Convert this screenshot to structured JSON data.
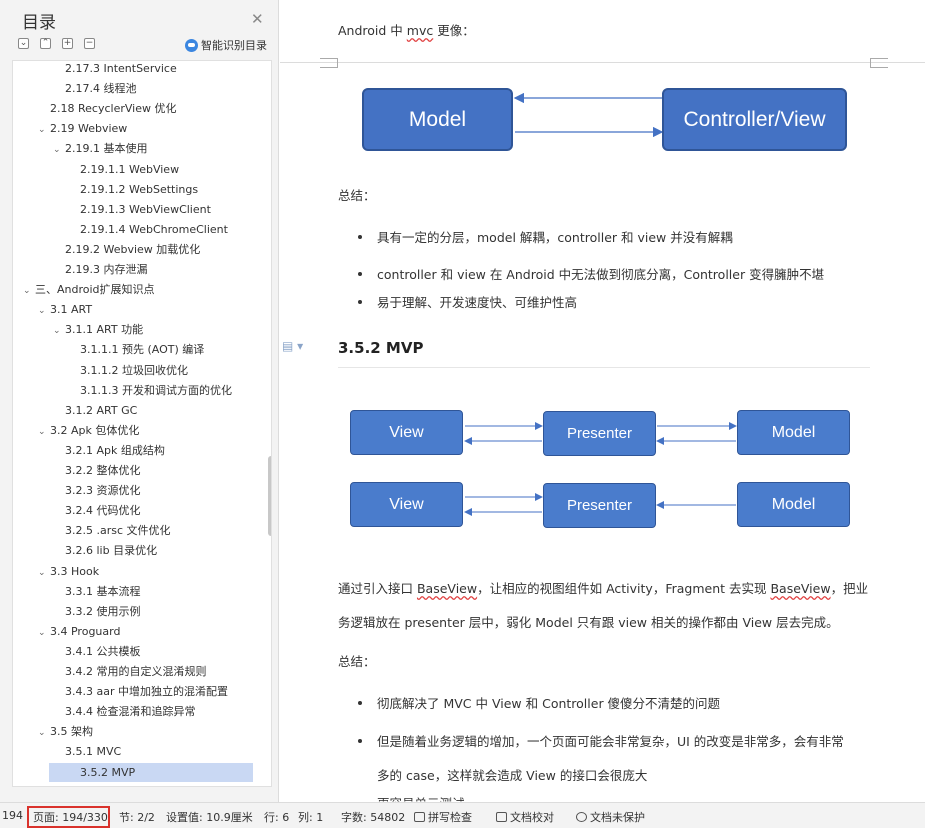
{
  "sidebar": {
    "title": "目录",
    "smart_label": "智能识别目录",
    "controls": [
      "⌄",
      "⌃",
      "+",
      "−"
    ],
    "toc": [
      {
        "label": "2.17.3 IntentService",
        "level": 2,
        "expand": ""
      },
      {
        "label": "2.17.4  线程池",
        "level": 2,
        "expand": ""
      },
      {
        "label": "2.18 RecyclerView 优化",
        "level": 1,
        "expand": ""
      },
      {
        "label": "2.19 Webview",
        "level": 1,
        "expand": "v"
      },
      {
        "label": "2.19.1  基本使用",
        "level": 2,
        "expand": "v"
      },
      {
        "label": "2.19.1.1 WebView",
        "level": 3,
        "expand": ""
      },
      {
        "label": "2.19.1.2 WebSettings",
        "level": 3,
        "expand": ""
      },
      {
        "label": "2.19.1.3 WebViewClient",
        "level": 3,
        "expand": ""
      },
      {
        "label": "2.19.1.4 WebChromeClient",
        "level": 3,
        "expand": ""
      },
      {
        "label": "2.19.2 Webview  加载优化",
        "level": 2,
        "expand": ""
      },
      {
        "label": "2.19.3  内存泄漏",
        "level": 2,
        "expand": ""
      },
      {
        "label": "三、Android扩展知识点",
        "level": 0,
        "expand": "v"
      },
      {
        "label": "3.1 ART",
        "level": 1,
        "expand": "v"
      },
      {
        "label": "3.1.1 ART  功能",
        "level": 2,
        "expand": "v"
      },
      {
        "label": "3.1.1.1  预先 (AOT) 编译",
        "level": 3,
        "expand": ""
      },
      {
        "label": "3.1.1.2  垃圾回收优化",
        "level": 3,
        "expand": ""
      },
      {
        "label": "3.1.1.3  开发和调试方面的优化",
        "level": 3,
        "expand": ""
      },
      {
        "label": "3.1.2 ART GC",
        "level": 2,
        "expand": ""
      },
      {
        "label": "3.2 Apk  包体优化",
        "level": 1,
        "expand": "v"
      },
      {
        "label": "3.2.1 Apk  组成结构",
        "level": 2,
        "expand": ""
      },
      {
        "label": "3.2.2  整体优化",
        "level": 2,
        "expand": ""
      },
      {
        "label": "3.2.3  资源优化",
        "level": 2,
        "expand": ""
      },
      {
        "label": "3.2.4  代码优化",
        "level": 2,
        "expand": ""
      },
      {
        "label": "3.2.5 .arsc 文件优化",
        "level": 2,
        "expand": ""
      },
      {
        "label": "3.2.6 lib 目录优化",
        "level": 2,
        "expand": ""
      },
      {
        "label": "3.3 Hook",
        "level": 1,
        "expand": "v"
      },
      {
        "label": "3.3.1  基本流程",
        "level": 2,
        "expand": ""
      },
      {
        "label": "3.3.2  使用示例",
        "level": 2,
        "expand": ""
      },
      {
        "label": "3.4 Proguard",
        "level": 1,
        "expand": "v"
      },
      {
        "label": "3.4.1  公共模板",
        "level": 2,
        "expand": ""
      },
      {
        "label": "3.4.2  常用的自定义混淆规则",
        "level": 2,
        "expand": ""
      },
      {
        "label": "3.4.3 aar 中增加独立的混淆配置",
        "level": 2,
        "expand": ""
      },
      {
        "label": "3.4.4  检查混淆和追踪异常",
        "level": 2,
        "expand": ""
      },
      {
        "label": "3.5  架构",
        "level": 1,
        "expand": "v"
      },
      {
        "label": "3.5.1 MVC",
        "level": 2,
        "expand": ""
      },
      {
        "label": "3.5.2 MVP",
        "level": 2,
        "expand": "",
        "selected": true
      }
    ]
  },
  "document": {
    "top_line_a": "Android  中  ",
    "top_line_mvc": "mvc",
    "top_line_b": " 更像：",
    "mvc_model": "Model",
    "mvc_controller": "Controller/View",
    "summary1": "总结：",
    "mvc_points": [
      "具有一定的分层，model  解耦，controller  和  view  并没有解耦",
      "controller  和  view  在  Android  中无法做到彻底分离，Controller  变得臃肿不堪",
      "易于理解、开发速度快、可维护性高"
    ],
    "heading": "3.5.2 MVP",
    "mvp_view": "View",
    "mvp_presenter": "Presenter",
    "mvp_model": "Model",
    "para1_a": "通过引入接口  ",
    "para1_base1": "BaseView",
    "para1_b": "，让相应的视图组件如  Activity，Fragment 去实现  ",
    "para1_base2": "BaseView",
    "para1_c": "，把业",
    "para2": "务逻辑放在  presenter  层中，弱化  Model  只有跟  view  相关的操作都由  View  层去完成。",
    "summary2": "总结：",
    "mvp_points": [
      "彻底解决了  MVC  中  View  和  Controller  傻傻分不清楚的问题",
      "但是随着业务逻辑的增加，一个页面可能会非常复杂，UI  的改变是非常多，会有非常",
      "多的  case，这样就会造成  View  的接口会很庞大"
    ],
    "cut_line": "更容易单元测试"
  },
  "status": {
    "left_num": "194",
    "page": "页面: 194/330",
    "section": "节: 2/2",
    "setting": "设置值: 10.9厘米",
    "row": "行: 6",
    "col": "列: 1",
    "words": "字数: 54802",
    "spell": "拼写检查",
    "proof": "文档校对",
    "protect": "文档未保护"
  },
  "colors": {
    "accent": "#4472c4",
    "selection": "#c9d8f3",
    "highlight_box": "#d9322c"
  }
}
